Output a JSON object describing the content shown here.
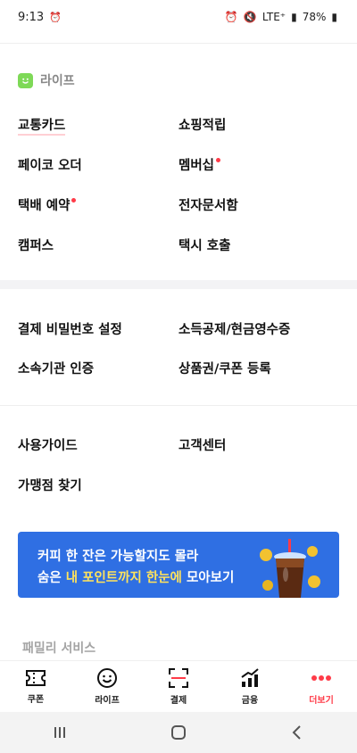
{
  "status_bar": {
    "time": "9:13",
    "network": "LTE⁺",
    "battery": "78%"
  },
  "life_section": {
    "title": "라이프",
    "items": [
      {
        "label": "교통카드",
        "dot": false
      },
      {
        "label": "쇼핑적립",
        "dot": false
      },
      {
        "label": "페이코 오더",
        "dot": false
      },
      {
        "label": "멤버십",
        "dot": true
      },
      {
        "label": "택배 예약",
        "dot": true
      },
      {
        "label": "전자문서함",
        "dot": false
      },
      {
        "label": "캠퍼스",
        "dot": false
      },
      {
        "label": "택시 호출",
        "dot": false
      }
    ]
  },
  "settings_section": {
    "items": [
      {
        "label": "결제 비밀번호 설정"
      },
      {
        "label": "소득공제/현금영수증"
      },
      {
        "label": "소속기관 인증"
      },
      {
        "label": "상품권/쿠폰 등록"
      }
    ]
  },
  "help_section": {
    "items": [
      {
        "label": "사용가이드"
      },
      {
        "label": "고객센터"
      },
      {
        "label": "가맹점 찾기"
      }
    ]
  },
  "banner": {
    "line1": "커피 한 잔은 가능할지도 몰라",
    "line2_prefix": "숨은 ",
    "line2_highlight": "내 포인트까지 한눈에",
    "line2_suffix": " 모아보기",
    "background_color": "#2f6fe3",
    "highlight_color": "#ffe35c"
  },
  "family_title": "패밀리 서비스",
  "bottom_nav": {
    "items": [
      {
        "label": "쿠폰",
        "icon": "ticket-icon",
        "active": false
      },
      {
        "label": "라이프",
        "icon": "smile-icon",
        "active": false
      },
      {
        "label": "결제",
        "icon": "scan-icon",
        "active": false
      },
      {
        "label": "금융",
        "icon": "chart-icon",
        "active": false
      },
      {
        "label": "더보기",
        "icon": "more-icon",
        "active": true
      }
    ]
  },
  "colors": {
    "accent_red": "#ff3b48",
    "life_green": "#7ed957"
  }
}
